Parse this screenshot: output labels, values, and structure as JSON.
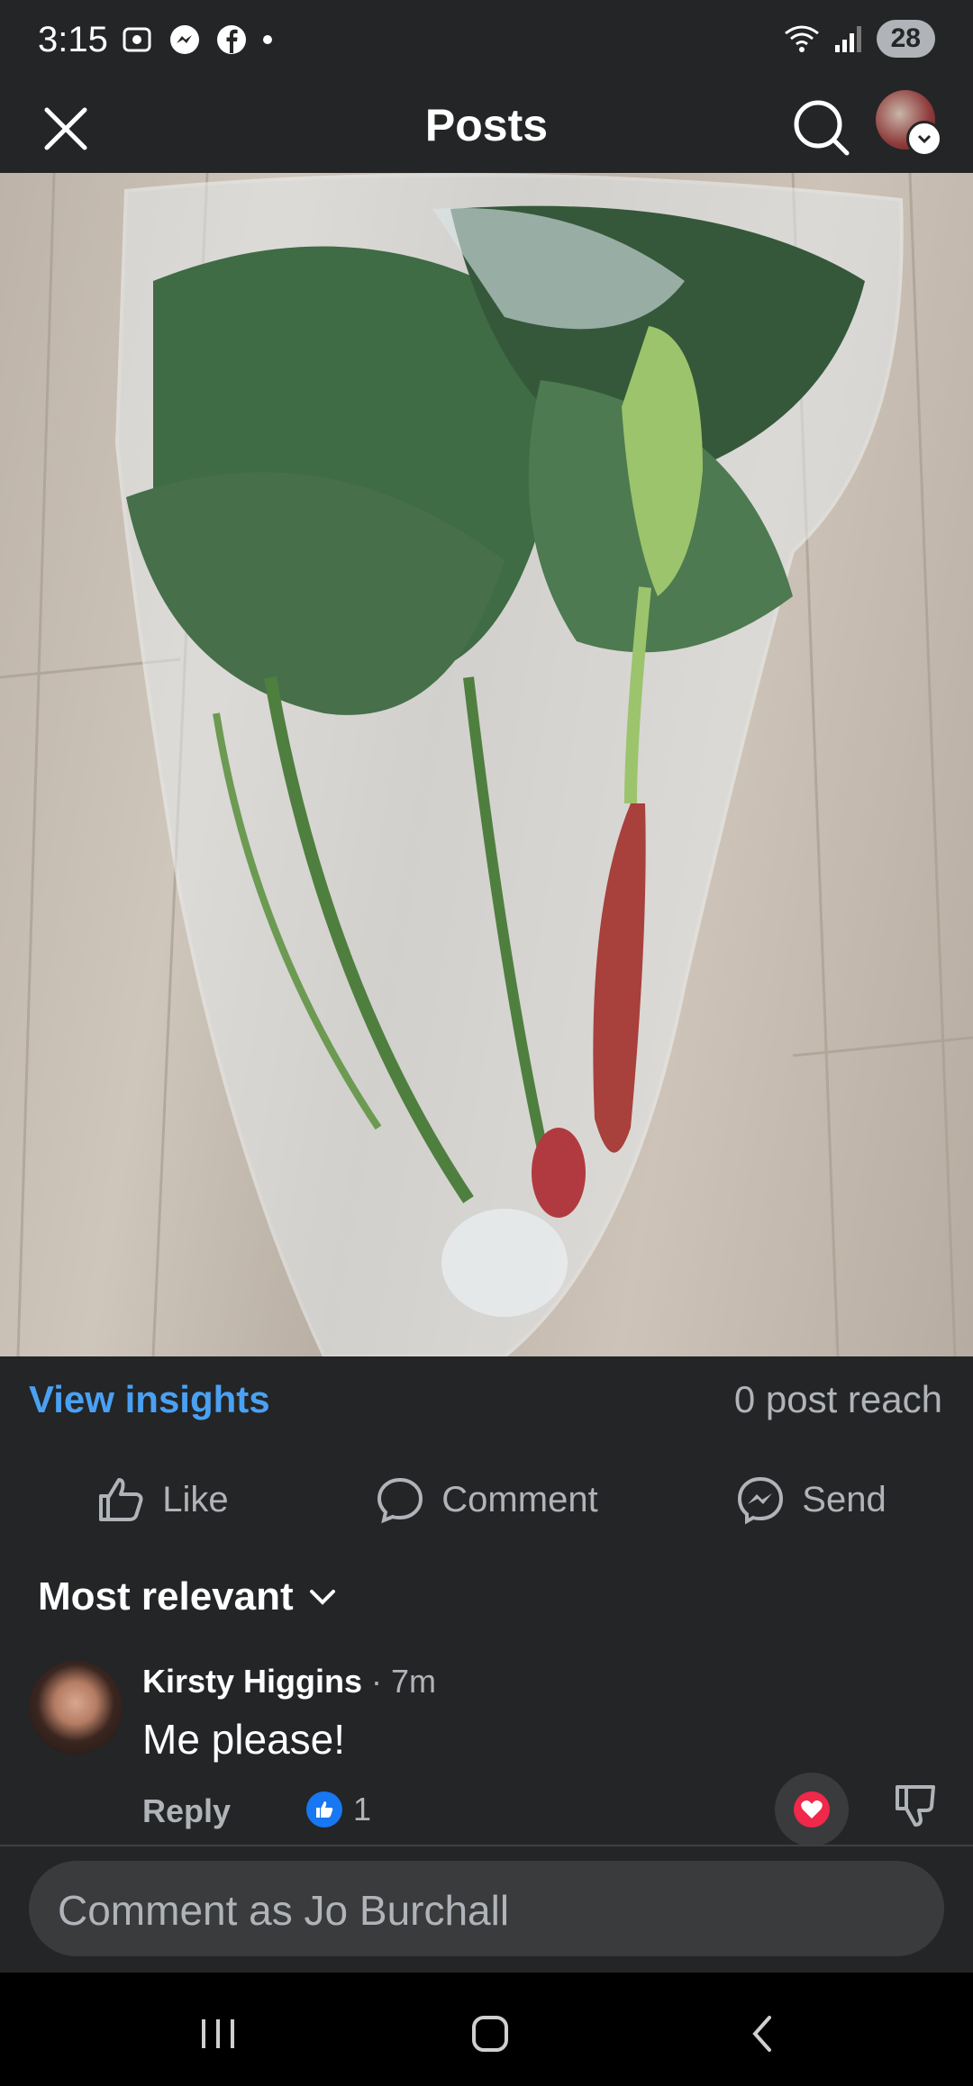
{
  "status_bar": {
    "time": "3:15",
    "battery": "28",
    "left_icons": [
      "screenshot-icon",
      "messenger-icon",
      "facebook-icon",
      "dot-icon"
    ],
    "right_icons": [
      "wifi-icon",
      "signal-icon"
    ]
  },
  "header": {
    "title": "Posts"
  },
  "post": {
    "image_alt": "Plant cutting in a clear plastic bag on a wooden floor"
  },
  "insights": {
    "link_label": "View insights",
    "reach": "0 post reach"
  },
  "actions": {
    "like": "Like",
    "comment": "Comment",
    "send": "Send"
  },
  "sort": {
    "label": "Most relevant"
  },
  "comment": {
    "author": "Kirsty Higgins",
    "time": " · 7m",
    "text": "Me please!",
    "reply_label": "Reply",
    "like_count": "1"
  },
  "composer": {
    "placeholder": "Comment as Jo Burchall"
  },
  "colors": {
    "background": "#242526",
    "link_blue": "#4aa1f3",
    "like_blue": "#1877f2",
    "heart_red": "#f0284a"
  }
}
